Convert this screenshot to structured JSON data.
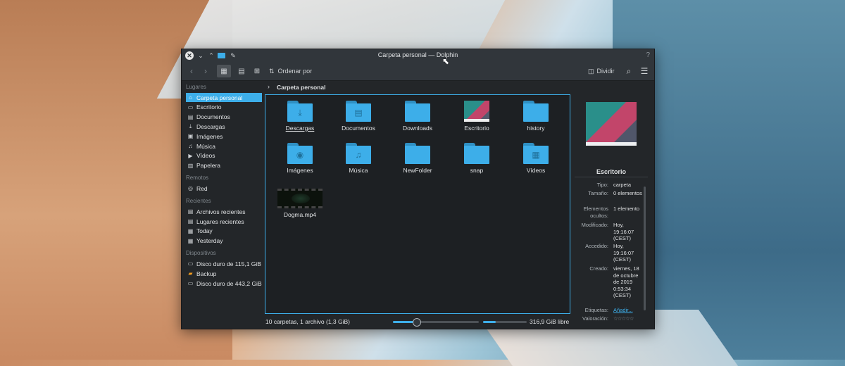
{
  "window": {
    "title": "Carpeta personal — Dolphin",
    "help_icon": "?"
  },
  "toolbar": {
    "sort_label": "Ordenar por",
    "split_label": "Dividir"
  },
  "sidebar": {
    "sections": [
      {
        "title": "Lugares",
        "items": [
          {
            "label": "Carpeta personal",
            "icon": "home-icon",
            "active": true
          },
          {
            "label": "Escritorio",
            "icon": "desktop-icon"
          },
          {
            "label": "Documentos",
            "icon": "document-icon"
          },
          {
            "label": "Descargas",
            "icon": "download-icon"
          },
          {
            "label": "Imágenes",
            "icon": "image-icon"
          },
          {
            "label": "Música",
            "icon": "music-icon"
          },
          {
            "label": "Vídeos",
            "icon": "video-icon"
          },
          {
            "label": "Papelera",
            "icon": "trash-icon"
          }
        ]
      },
      {
        "title": "Remotos",
        "items": [
          {
            "label": "Red",
            "icon": "network-icon"
          }
        ]
      },
      {
        "title": "Recientes",
        "items": [
          {
            "label": "Archivos recientes",
            "icon": "recent-files-icon"
          },
          {
            "label": "Lugares recientes",
            "icon": "recent-places-icon"
          },
          {
            "label": "Today",
            "icon": "calendar-icon"
          },
          {
            "label": "Yesterday",
            "icon": "calendar-icon"
          }
        ]
      },
      {
        "title": "Dispositivos",
        "items": [
          {
            "label": "Disco duro de 115,1 GiB",
            "icon": "drive-icon"
          },
          {
            "label": "Backup",
            "icon": "drive-orange-icon"
          },
          {
            "label": "Disco duro de 443,2 GiB",
            "icon": "drive-icon"
          }
        ]
      }
    ]
  },
  "breadcrumb": {
    "current": "Carpeta personal"
  },
  "files": [
    {
      "name": "Descargas",
      "kind": "folder",
      "emblem": "download-icon",
      "selected": true
    },
    {
      "name": "Documentos",
      "kind": "folder",
      "emblem": "document-icon"
    },
    {
      "name": "Downloads",
      "kind": "folder",
      "emblem": ""
    },
    {
      "name": "Escritorio",
      "kind": "desktop-thumbnail"
    },
    {
      "name": "history",
      "kind": "folder",
      "emblem": ""
    },
    {
      "name": "Imágenes",
      "kind": "folder",
      "emblem": "image-preview-icon"
    },
    {
      "name": "Música",
      "kind": "folder",
      "emblem": "music-icon"
    },
    {
      "name": "NewFolder",
      "kind": "folder",
      "emblem": ""
    },
    {
      "name": "snap",
      "kind": "folder",
      "emblem": ""
    },
    {
      "name": "Vídeos",
      "kind": "folder",
      "emblem": "video-preview-icon"
    },
    {
      "name": "Dogma.mp4",
      "kind": "video-thumbnail"
    }
  ],
  "info_panel": {
    "name": "Escritorio",
    "fields": [
      {
        "key": "Tipo:",
        "value": "carpeta"
      },
      {
        "key": "Tamaño:",
        "value": "0 elementos"
      },
      {
        "key": "Elementos ocultos:",
        "value": "1 elemento"
      },
      {
        "key": "Modificado:",
        "value": "Hoy, 19:16:07 (CEST)"
      },
      {
        "key": "Accedido:",
        "value": "Hoy, 19:16:07 (CEST)"
      },
      {
        "key": "Creado:",
        "value": "viernes, 18 de octubre de 2019 0:53:34 (CEST)"
      },
      {
        "key": "Etiquetas:",
        "value": "Añadir..."
      },
      {
        "key": "Valoración:",
        "value": "☆☆☆☆☆"
      }
    ]
  },
  "status": {
    "summary": "10 carpetas, 1 archivo (1,3 GiB)",
    "zoom_fraction": 0.27,
    "free_space": "316,9 GiB libre",
    "used_fraction": 0.29
  },
  "colors": {
    "accent": "#3daee9",
    "window_bg": "#232629",
    "toolbar_bg": "#31363b"
  }
}
